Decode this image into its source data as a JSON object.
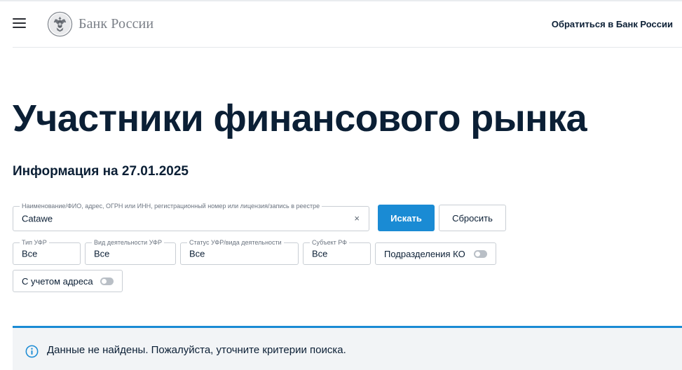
{
  "header": {
    "logo_text": "Банк России",
    "contact_link": "Обратиться в Банк России"
  },
  "page": {
    "title": "Участники финансового рынка",
    "info_date": "Информация на 27.01.2025"
  },
  "search": {
    "label": "Наименование/ФИО, адрес, ОГРН или ИНН, регистрационный номер или лицензия/запись в реестре",
    "value": "Catawe",
    "clear_glyph": "×",
    "submit_label": "Искать",
    "reset_label": "Сбросить"
  },
  "filters": {
    "ufr_type": {
      "label": "Тип УФР",
      "value": "Все"
    },
    "activity": {
      "label": "Вид деятельности УФР",
      "value": "Все"
    },
    "status": {
      "label": "Статус УФР/вида деятельности",
      "value": "Все"
    },
    "region": {
      "label": "Субъект РФ",
      "value": "Все"
    },
    "ko_divisions": {
      "label": "Подразделения КО",
      "enabled": false
    },
    "address": {
      "label": "С учетом адреса",
      "enabled": false
    }
  },
  "notice": {
    "text": "Данные не найдены. Пожалуйста, уточните критерии поиска.",
    "icon": "info-icon"
  },
  "colors": {
    "accent": "#1a8bd4",
    "text": "#0b1f35",
    "notice_bg": "#f2f4f6",
    "toggle_off": "#b9bfc6"
  },
  "icons": [
    "menu-icon",
    "bank-emblem-icon",
    "clear-icon",
    "info-icon"
  ]
}
